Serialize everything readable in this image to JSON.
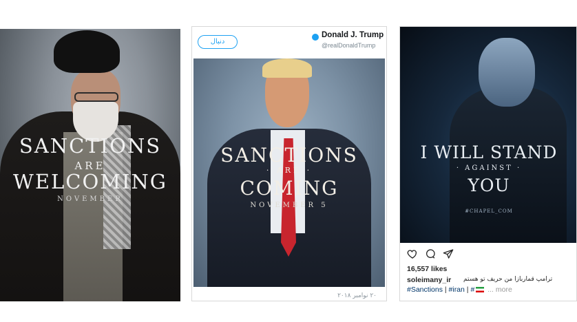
{
  "panel_left": {
    "line1": "SANCTIONS",
    "line2": "ARE",
    "line3": "WELCOMING",
    "line4": "NOVEMBER"
  },
  "panel_middle": {
    "follow_label": "دنبال",
    "author_name": "Donald J. Trump",
    "author_handle": "@realDonaldTrump",
    "line1": "SANCTIONS",
    "line2": "· ARE ·",
    "line3": "COMING",
    "line4": "NOVEMBER 5",
    "date": "۲۰ نوامبر ۲۰۱۸"
  },
  "panel_right": {
    "line1": "I WILL STAND",
    "line2": "· AGAINST ·",
    "line3": "YOU",
    "watermark": "#CHAPEL_COM",
    "likes": "16,557 likes",
    "username": "soleimany_ir",
    "caption": "ترامپ قماربازا من حریف تو هستم",
    "tag1": "#Sanctions",
    "tag2": "#iran",
    "tag3": "#",
    "more": "... more"
  },
  "colors": {
    "twitter_blue": "#1da1f2",
    "tie_red": "#c8252e",
    "instagram_link": "#003569"
  },
  "icons": [
    "heart-icon",
    "comment-icon",
    "share-icon",
    "verified-badge-icon"
  ]
}
